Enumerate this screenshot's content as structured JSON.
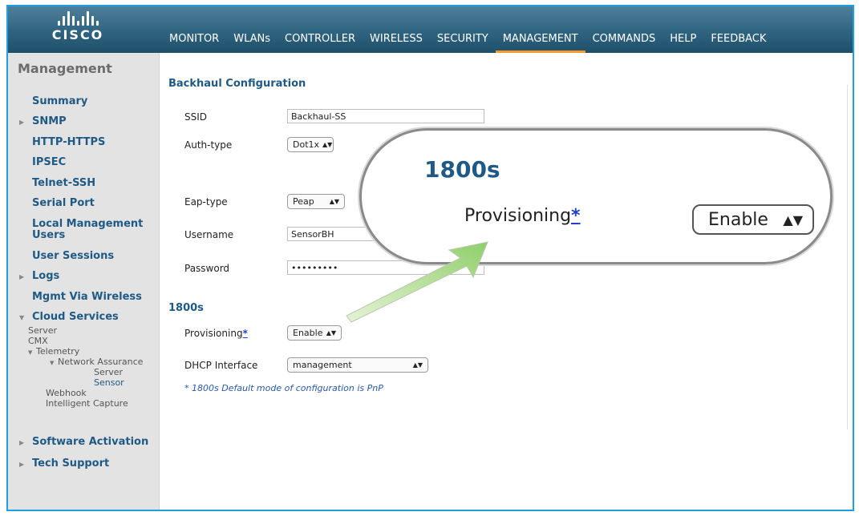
{
  "brand": {
    "name": "CISCO"
  },
  "nav": [
    {
      "label": "MONITOR",
      "active": false
    },
    {
      "label": "WLANs",
      "active": false
    },
    {
      "label": "CONTROLLER",
      "active": false
    },
    {
      "label": "WIRELESS",
      "active": false
    },
    {
      "label": "SECURITY",
      "active": false
    },
    {
      "label": "MANAGEMENT",
      "active": true
    },
    {
      "label": "COMMANDS",
      "active": false
    },
    {
      "label": "HELP",
      "active": false
    },
    {
      "label": "FEEDBACK",
      "active": false
    }
  ],
  "sidebar": {
    "title": "Management",
    "items": [
      {
        "label": "Summary"
      },
      {
        "label": "SNMP"
      },
      {
        "label": "HTTP-HTTPS"
      },
      {
        "label": "IPSEC"
      },
      {
        "label": "Telnet-SSH"
      },
      {
        "label": "Serial Port"
      },
      {
        "label": "Local Management"
      },
      {
        "label": "Users"
      },
      {
        "label": "User Sessions"
      },
      {
        "label": "Logs"
      },
      {
        "label": "Mgmt Via Wireless"
      },
      {
        "label": "Cloud Services"
      },
      {
        "label": "Software Activation"
      },
      {
        "label": "Tech Support"
      }
    ],
    "cloud_sub": {
      "server": "Server",
      "cmx": "CMX",
      "telemetry": "Telemetry",
      "network_assurance": "Network Assurance",
      "na_server": "Server",
      "na_sensor": "Sensor",
      "webhook": "Webhook",
      "intelligent_capture": "Intelligent Capture"
    }
  },
  "main": {
    "section_title": "Backhaul Configuration",
    "ssid_label": "SSID",
    "ssid_value": "Backhaul-SS",
    "auth_label": "Auth-type",
    "auth_value": "Dot1x",
    "eap_label": "Eap-type",
    "eap_value": "Peap",
    "username_label": "Username",
    "username_value": "SensorBH",
    "password_label": "Password",
    "password_value": "•••••••••",
    "section2_title": "1800s",
    "provisioning_label": "Provisioning",
    "provisioning_asterisk": "*",
    "provisioning_value": "Enable",
    "dhcp_label": "DHCP Interface",
    "dhcp_value": "management",
    "footnote": "* 1800s Default mode of configuration is PnP"
  },
  "callout": {
    "title": "1800s",
    "label": "Provisioning",
    "asterisk": "*",
    "value": "Enable"
  },
  "colors": {
    "accent": "#f49b2a",
    "link": "#1f5a86",
    "header": "#2f6480",
    "frame": "#1ea0e0"
  }
}
